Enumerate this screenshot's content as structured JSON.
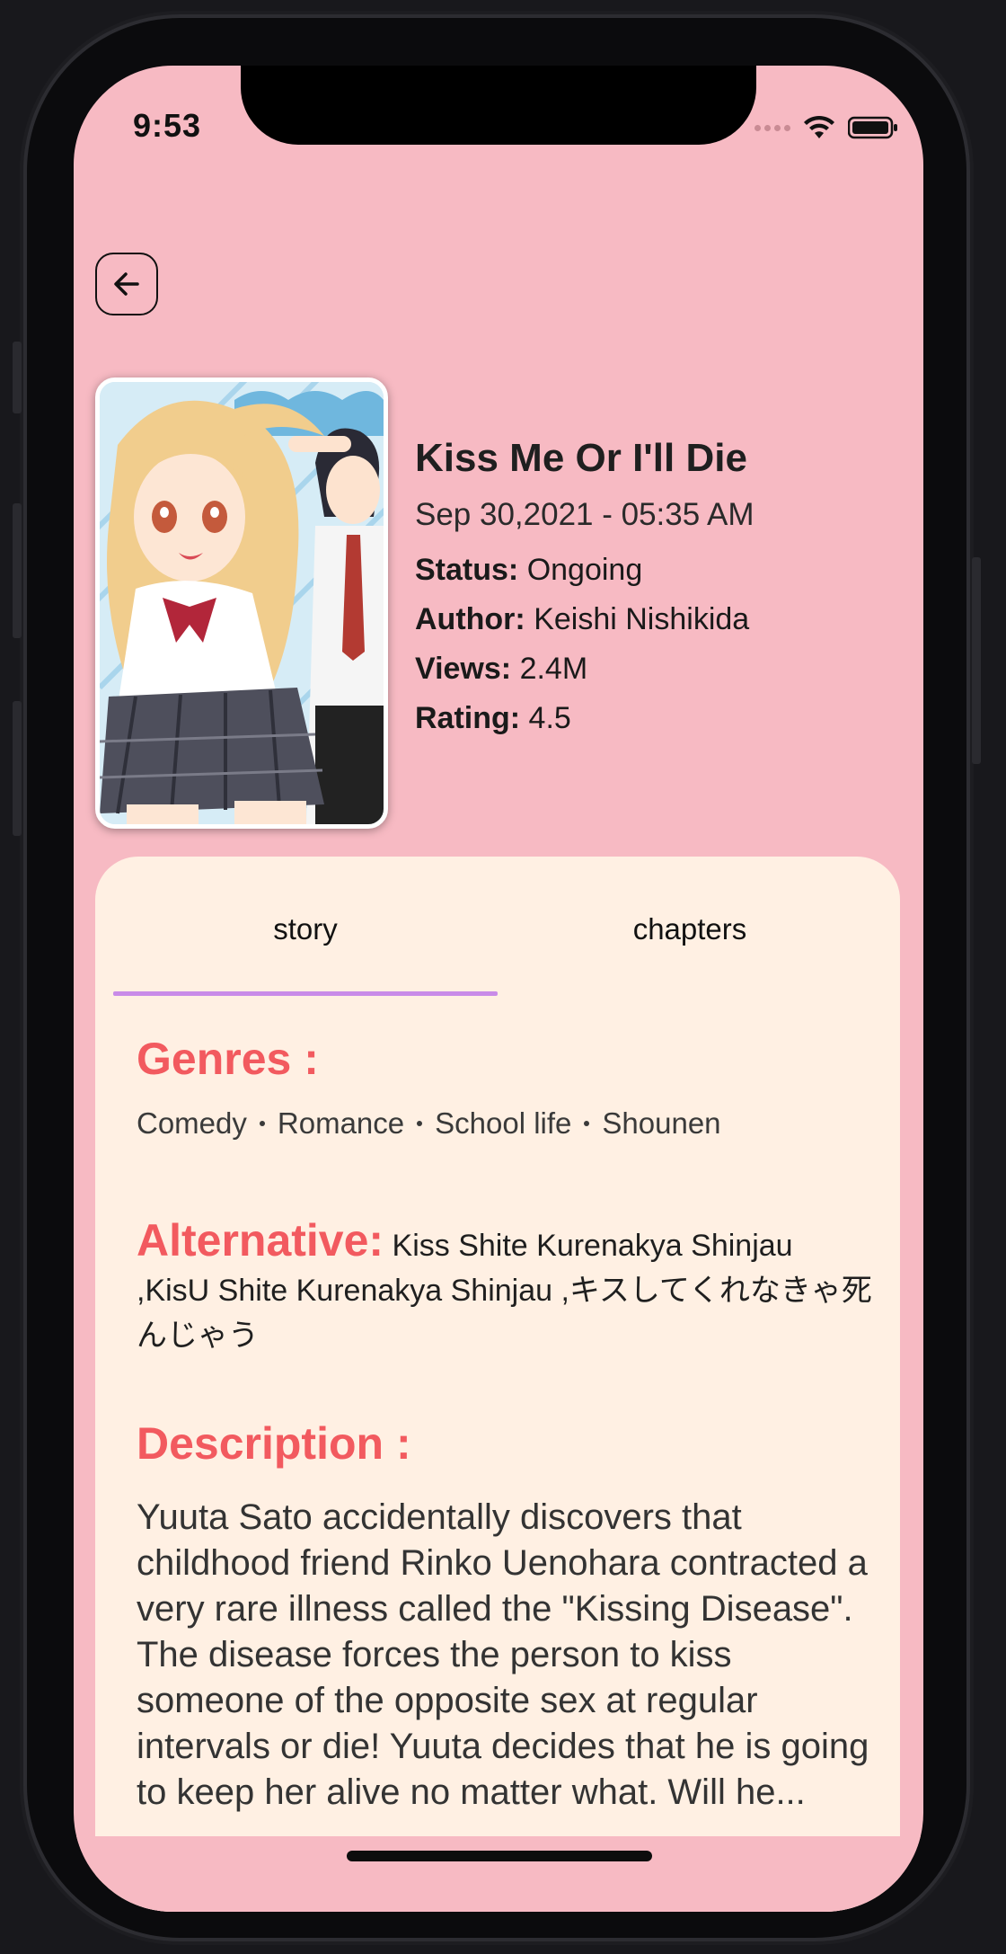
{
  "status_bar": {
    "time": "9:53"
  },
  "manga": {
    "title": "Kiss Me Or I'll Die",
    "date": "Sep 30,2021 - 05:35 AM",
    "status_label": "Status:",
    "status_value": "Ongoing",
    "author_label": "Author:",
    "author_value": "Keishi Nishikida",
    "views_label": "Views:",
    "views_value": "2.4M",
    "rating_label": "Rating:",
    "rating_value": "4.5"
  },
  "tabs": [
    {
      "label": "story",
      "active": true
    },
    {
      "label": "chapters",
      "active": false
    }
  ],
  "story": {
    "genres_heading": "Genres :",
    "genres": [
      "Comedy",
      "Romance",
      "School life",
      "Shounen"
    ],
    "alternative_heading": "Alternative:",
    "alternative_text": "Kiss Shite Kurenakya Shinjau ,KisU Shite Kurenakya Shinjau ,キスしてくれなきゃ死んじゃう",
    "description_heading": "Description :",
    "description_text": "Yuuta Sato accidentally discovers that childhood friend Rinko Uenohara contracted a very rare illness called the \"Kissing Disease\". The disease forces the person to kiss someone of the opposite sex at regular intervals or die! Yuuta decides that he is going to keep her alive no matter what. Will he..."
  },
  "colors": {
    "background": "#f7bac3",
    "card": "#fff0e3",
    "heading": "#f25a5f",
    "tab_indicator": "#c98be8"
  },
  "icons": [
    "back-arrow-icon",
    "wifi-icon",
    "battery-icon",
    "signal-icon"
  ]
}
